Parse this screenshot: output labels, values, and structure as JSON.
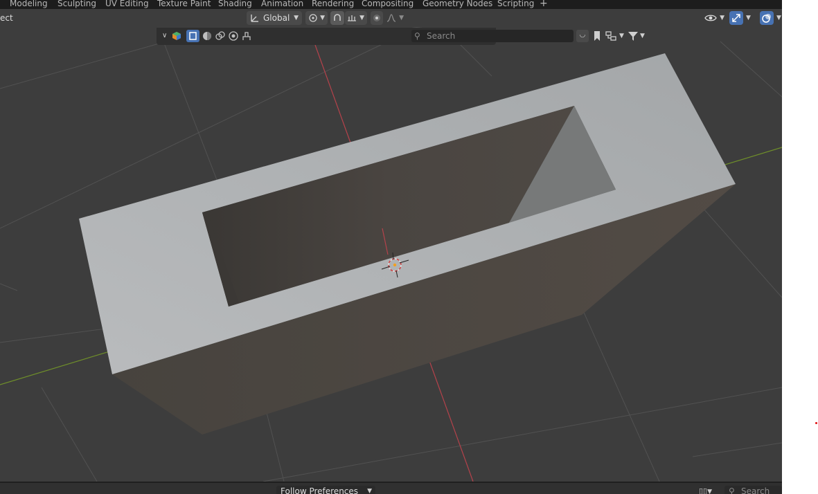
{
  "workspace_tabs": [
    "Modeling",
    "Sculpting",
    "UV Editing",
    "Texture Paint",
    "Shading",
    "Animation",
    "Rendering",
    "Compositing",
    "Geometry Nodes",
    "Scripting"
  ],
  "workspace_add": "+",
  "header": {
    "mode_label_fragment": "ect",
    "transform_orientation": "Global",
    "icons": [
      "transform-orientation-icon",
      "pivot-point-icon",
      "snap-icon",
      "snap-increment-icon",
      "proportional-editing-icon",
      "falloff-icon",
      "visibility-icon",
      "gizmo-icon",
      "overlay-icon"
    ]
  },
  "outliner_header": {
    "search_placeholder": "Search",
    "icons": [
      "chevron-down-icon",
      "object-color-icon",
      "solid-select-icon",
      "material-icon",
      "render-icon",
      "shading-icon",
      "brush-icon",
      "search-icon",
      "bookmark-icon",
      "filter-icon"
    ]
  },
  "viewport": {
    "object": "hollow rectangular box",
    "colors": {
      "background": "#3d3d3d",
      "grid": "#4f4f4f",
      "x_axis": "#b5424b",
      "y_axis": "#7a9a2e",
      "top_face": "#b1b3b5",
      "inner_wall": "#4a4541",
      "outer_wall": "#4c4843"
    }
  },
  "bottombar": {
    "preference_select": "Follow Preferences",
    "search_placeholder": "Search"
  }
}
